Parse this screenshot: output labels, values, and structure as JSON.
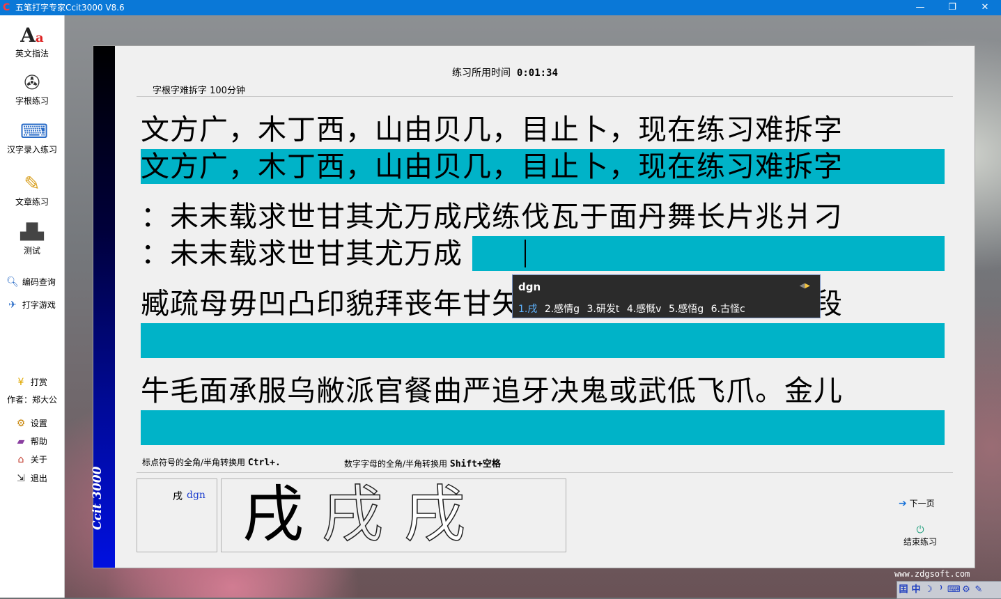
{
  "window": {
    "title": "五笔打字专家Ccit3000 V8.6",
    "minimize": "—",
    "maximize": "❐",
    "close": "✕"
  },
  "sidebar": {
    "main_items": [
      {
        "label": "英文指法",
        "icon": "letters-icon"
      },
      {
        "label": "字根练习",
        "icon": "film-reel-icon"
      },
      {
        "label": "汉字录入练习",
        "icon": "typing-figure-icon"
      },
      {
        "label": "文章练习",
        "icon": "pencils-icon"
      },
      {
        "label": "测试",
        "icon": "podium-icon"
      }
    ],
    "links": [
      {
        "label": "编码查询",
        "icon": "magnifier-icon"
      },
      {
        "label": "打字游戏",
        "icon": "game-icon"
      }
    ],
    "reward": {
      "label": "打赏",
      "author": "作者：郑大公"
    },
    "bottom": [
      {
        "label": "设置",
        "icon": "gear-icon"
      },
      {
        "label": "帮助",
        "icon": "book-icon"
      },
      {
        "label": "关于",
        "icon": "house-icon"
      },
      {
        "label": "退出",
        "icon": "exit-icon"
      }
    ]
  },
  "practice": {
    "timer_label": "练习所用时间",
    "timer_value": "0:01:34",
    "subtitle": "字根字难拆字  100分钟",
    "lines": [
      {
        "source": "文方广，木丁西，山由贝几，目止卜，现在练习难拆字",
        "typed": "文方广，木丁西，山由贝几，目止卜，现在练习难拆字"
      },
      {
        "source": "：未末载求世甘其尤万成戌练伐瓦于面丹舞长片兆爿刁",
        "typed": "：未末载求世甘其尤万成"
      },
      {
        "source": "臧疏母毋凹凸印貌拜丧年甘矢先县糟卵卫丘友革予张段",
        "typed": ""
      },
      {
        "source": "牛毛面承服乌敝派官餐曲严追牙决鬼或武低飞爪。金儿",
        "typed": ""
      }
    ],
    "note_left_label": "标点符号的全角/半角转换用",
    "note_left_key": "Ctrl+.",
    "note_right_label": "数字字母的全角/半角转换用",
    "note_right_key": "Shift+空格",
    "hint_char": "戌",
    "hint_code": "dgn",
    "stroke_char": "戌",
    "next_page": "下一页",
    "end_practice": "结束练习",
    "strip_text": "Ccit 3000"
  },
  "ime": {
    "input": "dgn",
    "candidates": [
      "1.戌",
      "2.感情g",
      "3.研发t",
      "4.感慨v",
      "5.感悟g",
      "6.古怪c"
    ]
  },
  "watermark": "www.zdgsoft.com",
  "tray": [
    "囯",
    "中",
    "☽",
    "⁾",
    "⌨",
    "⚙",
    "✎"
  ]
}
